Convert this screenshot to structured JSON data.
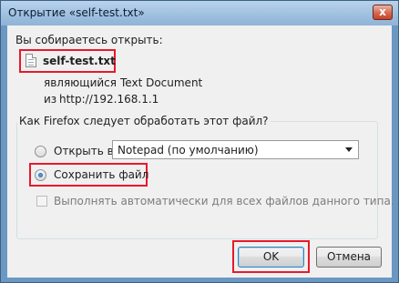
{
  "window": {
    "title": "Открытие «self-test.txt»",
    "close_symbol": "x"
  },
  "header": {
    "intro": "Вы собираетесь открыть:",
    "file_icon": "text-file-icon",
    "file_name": "self-test.txt",
    "type_label": "являющийся",
    "type_value": "Text Document",
    "from_label": "из",
    "from_value": "http://192.168.1.1"
  },
  "action_group": {
    "label": "Как Firefox следует обработать этот файл?",
    "open_with_label": "Открыть в",
    "open_with_app": "Notepad (по умолчанию)",
    "save_label": "Сохранить файл",
    "selected": "save",
    "auto_label": "Выполнять автоматически для всех файлов данного типа.",
    "auto_checked": false
  },
  "buttons": {
    "ok": "OK",
    "cancel": "Отмена"
  },
  "colors": {
    "highlight": "#e8192c",
    "title_bar": "#9dbfdf"
  }
}
